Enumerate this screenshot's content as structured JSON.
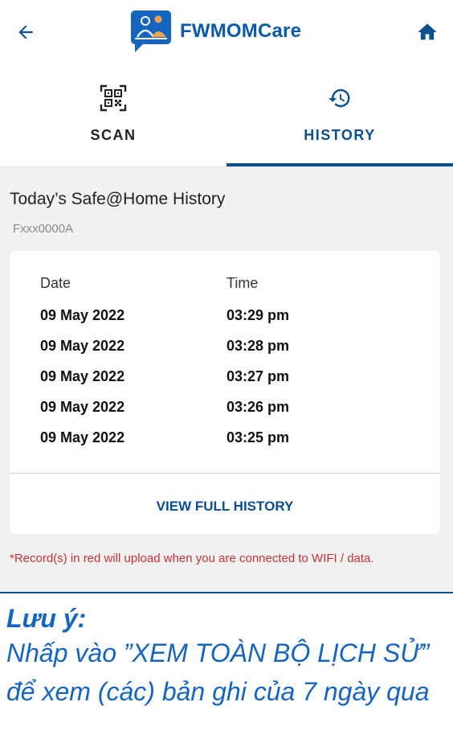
{
  "header": {
    "app_name": "FWMOMCare",
    "back_icon": "arrow-left-icon",
    "home_icon": "home-icon",
    "accent_color": "#0b5aa7"
  },
  "tabs": [
    {
      "label": "SCAN",
      "icon": "qr-code-icon",
      "active": false
    },
    {
      "label": "HISTORY",
      "icon": "history-icon",
      "active": true
    }
  ],
  "history": {
    "title": "Today’s Safe@Home History",
    "user_id": "Fxxx0000A",
    "columns": {
      "date": "Date",
      "time": "Time"
    },
    "rows": [
      {
        "date": "09 May 2022",
        "time": "03:29 pm"
      },
      {
        "date": "09 May 2022",
        "time": "03:28 pm"
      },
      {
        "date": "09 May 2022",
        "time": "03:27 pm"
      },
      {
        "date": "09 May 2022",
        "time": "03:26 pm"
      },
      {
        "date": "09 May 2022",
        "time": "03:25 pm"
      }
    ],
    "view_full_label": "VIEW FULL HISTORY",
    "note": "*Record(s) in red will upload when you are connected to WIFI / data."
  },
  "caption": {
    "title": "Lưu ý:",
    "body": "Nhấp vào ”XEM TOÀN BỘ LỊCH SỬ” để xem (các) bản ghi của 7 ngày qua"
  }
}
